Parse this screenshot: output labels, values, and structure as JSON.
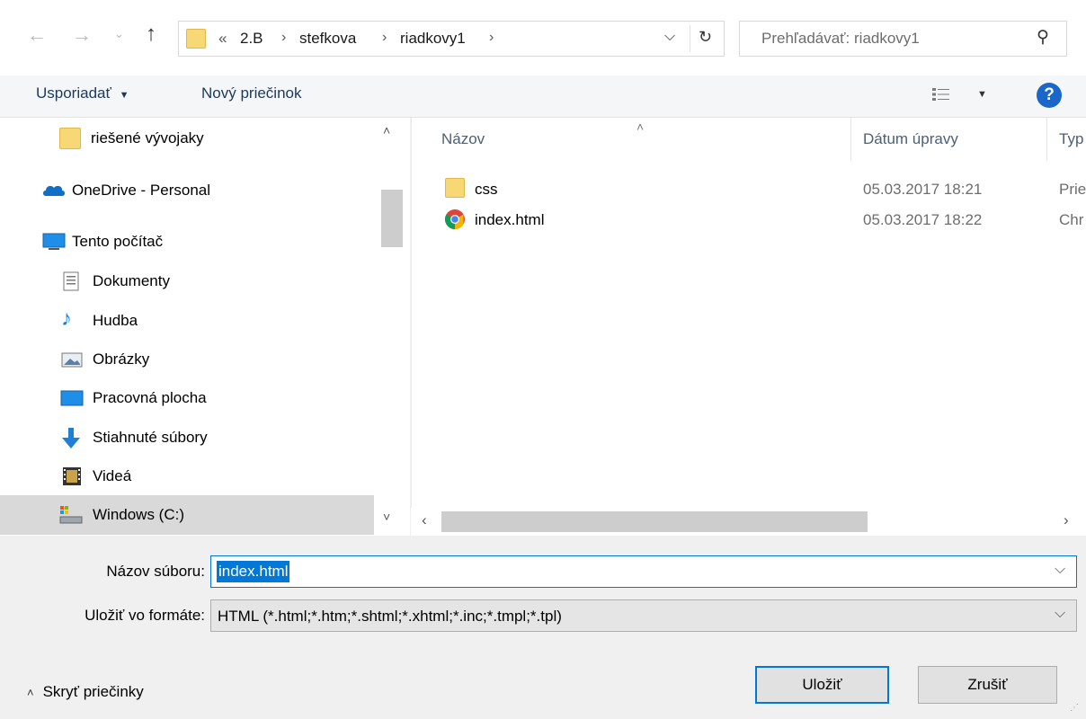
{
  "address": {
    "overflow": "«",
    "crumbs": [
      "2.B",
      "stefkova",
      "riadkovy1"
    ],
    "search_placeholder": "Prehľadávať: riadkovy1"
  },
  "toolbar": {
    "organize_label": "Usporiadať",
    "new_folder_label": "Nový priečinok"
  },
  "nav": {
    "items": [
      {
        "label": "riešené vývojaky",
        "icon": "folder-icon"
      },
      {
        "label": "OneDrive - Personal",
        "icon": "onedrive-icon"
      },
      {
        "label": "Tento počítač",
        "icon": "computer-icon"
      },
      {
        "label": "Dokumenty",
        "icon": "documents-icon"
      },
      {
        "label": "Hudba",
        "icon": "music-icon"
      },
      {
        "label": "Obrázky",
        "icon": "pictures-icon"
      },
      {
        "label": "Pracovná plocha",
        "icon": "desktop-icon"
      },
      {
        "label": "Stiahnuté súbory",
        "icon": "downloads-icon"
      },
      {
        "label": "Videá",
        "icon": "videos-icon"
      },
      {
        "label": "Windows (C:)",
        "icon": "drive-icon",
        "selected": true
      }
    ]
  },
  "list": {
    "columns": [
      "Názov",
      "Dátum úpravy",
      "Typ"
    ],
    "rows": [
      {
        "name": "css",
        "date": "05.03.2017 18:21",
        "type": "Prie",
        "icon": "folder-icon"
      },
      {
        "name": "index.html",
        "date": "05.03.2017 18:22",
        "type": "Chr",
        "icon": "chrome-icon"
      }
    ]
  },
  "form": {
    "filename_label": "Názov súboru:",
    "filename_value": "index.html",
    "filetype_label": "Uložiť vo formáte:",
    "filetype_value": "HTML (*.html;*.htm;*.shtml;*.xhtml;*.inc;*.tmpl;*.tpl)"
  },
  "footer": {
    "hide_folders_label": "Skryť priečinky",
    "save_label": "Uložiť",
    "cancel_label": "Zrušiť"
  },
  "colors": {
    "accent": "#0078d7",
    "folder": "#f8d775",
    "selected_nav": "#d9d9d9",
    "help": "#1a66c9"
  }
}
